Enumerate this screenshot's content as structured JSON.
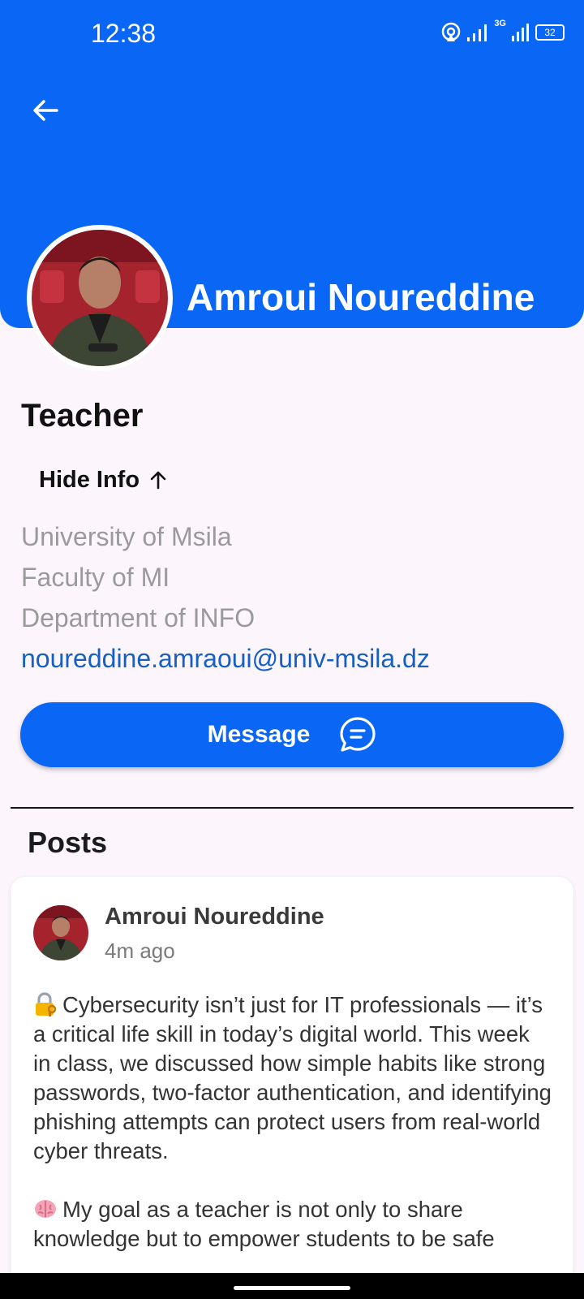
{
  "status_bar": {
    "time": "12:38",
    "battery": "32",
    "network": "3G"
  },
  "header": {
    "profile_name": "Amroui Noureddine"
  },
  "profile": {
    "role": "Teacher",
    "toggle_info_label": "Hide Info",
    "info": {
      "university": "University of Msila",
      "faculty": "Faculty of MI",
      "department": "Department of INFO",
      "email": "noureddine.amraoui@univ-msila.dz"
    },
    "message_button_label": "Message"
  },
  "posts": {
    "title": "Posts",
    "items": [
      {
        "author": "Amroui Noureddine",
        "time": "4m ago",
        "paragraph_1": "Cybersecurity isn’t just for IT professionals — it’s a critical life skill in today’s digital world. This week in class, we discussed how simple habits like strong passwords, two-factor authentication, and identifying phishing attempts can protect users from real-world cyber threats.",
        "paragraph_2": "My goal as a teacher is not only to share knowledge but to empower students to be safe"
      }
    ]
  },
  "colors": {
    "primary": "#0a66f4",
    "background": "#fcf5fc",
    "link": "#1560c2",
    "muted_text": "#9a9a9a"
  },
  "icons": {
    "back": "arrow-left-icon",
    "toggle": "arrow-up-icon",
    "message": "chat-bubble-icon",
    "post_emoji_1": "lock-key-emoji",
    "post_emoji_2": "brain-emoji"
  }
}
